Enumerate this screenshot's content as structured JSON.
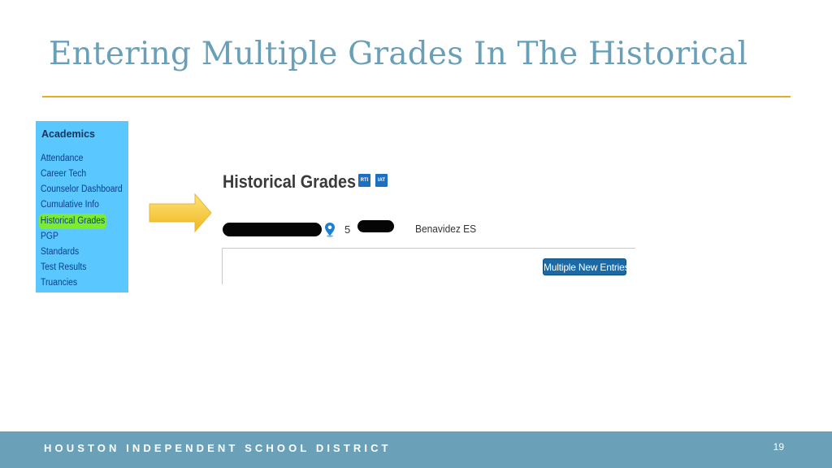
{
  "slide": {
    "title": "Entering Multiple Grades In The Historical",
    "colors": {
      "title": "#6a9fb8",
      "rule": "#e4ac2a",
      "footer": "#6aa0b8"
    }
  },
  "sidebar": {
    "heading": "Academics",
    "items": [
      {
        "label": "Attendance"
      },
      {
        "label": "Career Tech"
      },
      {
        "label": "Counselor Dashboard"
      },
      {
        "label": "Cumulative Info"
      },
      {
        "label": "Historical Grades",
        "highlighted": true
      },
      {
        "label": "PGP"
      },
      {
        "label": "Standards"
      },
      {
        "label": "Test Results"
      },
      {
        "label": "Truancies"
      }
    ],
    "background": "#5ac8ff",
    "highlight_color": "#7cec2e"
  },
  "callout": {
    "icon": "right-arrow-icon",
    "color": "#f5c72a"
  },
  "panel": {
    "title": "Historical Grades",
    "badges": {
      "rti": "RTI",
      "iat": "IAT"
    },
    "student": {
      "grade": "5",
      "school": "Benavidez ES",
      "location_icon": "map-pin-icon"
    },
    "button_label": "Multiple New Entries",
    "button_color": "#1b6aa6"
  },
  "footer": {
    "district": "HOUSTON INDEPENDENT SCHOOL DISTRICT",
    "page_number": "19"
  }
}
